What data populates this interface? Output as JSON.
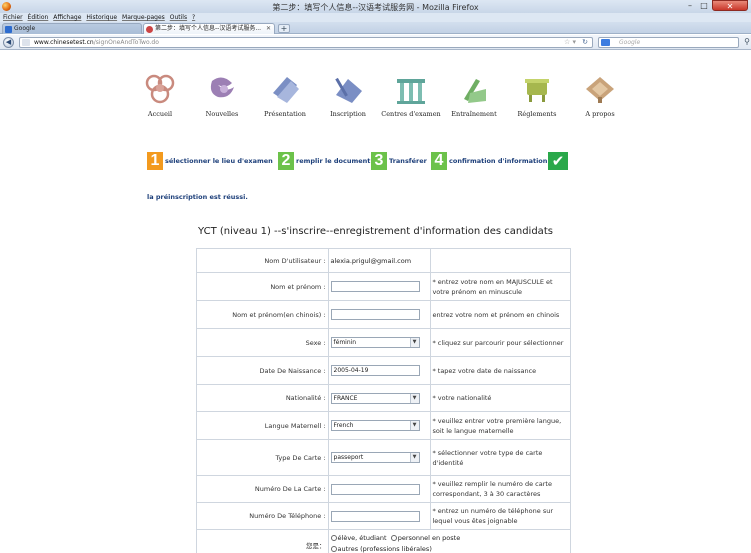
{
  "browser": {
    "window_title": "第二步：填写个人信息--汉语考试服务网 - Mozilla Firefox",
    "menu": [
      "Fichier",
      "Édition",
      "Affichage",
      "Historique",
      "Marque-pages",
      "Outils",
      "?"
    ],
    "tabs": [
      {
        "label": "Google"
      },
      {
        "label": "第二步：填写个人信息--汉语考试服务..."
      }
    ],
    "url_host": "www.chinesetest.cn",
    "url_path": "/signOneAndToTwo.do",
    "search_placeholder": "Google"
  },
  "nav": [
    {
      "label": "Accueil",
      "icon": "home-icon"
    },
    {
      "label": "Nouvelles",
      "icon": "news-icon"
    },
    {
      "label": "Présentation",
      "icon": "presentation-icon"
    },
    {
      "label": "Inscription",
      "icon": "inscription-icon"
    },
    {
      "label": "Centres d'examen",
      "icon": "exam-center-icon"
    },
    {
      "label": "Entraînement",
      "icon": "training-icon"
    },
    {
      "label": "Réglements",
      "icon": "rules-icon"
    },
    {
      "label": "A propos",
      "icon": "about-icon"
    }
  ],
  "steps": [
    {
      "num": "1",
      "label": "sélectionner le lieu d'examen",
      "color": "#f39a1e"
    },
    {
      "num": "2",
      "label": "remplir le document",
      "color": "#6cc24a"
    },
    {
      "num": "3",
      "label": "Transférer",
      "color": "#6cc24a"
    },
    {
      "num": "4",
      "label": "confirmation d'information",
      "color": "#6cc24a"
    }
  ],
  "success_message": "la préinscription est réussi.",
  "form_title": "YCT (niveau 1) --s'inscrire--enregistrement d'information des candidats",
  "form": {
    "username_label": "Nom D'utilisateur :",
    "username_value": "alexia.prigul@gmail.com",
    "rows": [
      {
        "label": "Nom et prénom :",
        "type": "input",
        "value": "",
        "hint": "* entrez votre nom en MAJUSCULE et votre prénom en minuscule"
      },
      {
        "label": "Nom et prénom(en chinois) :",
        "type": "input",
        "value": "",
        "hint": " entrez votre nom et prénom en chinois"
      },
      {
        "label": "Sexe :",
        "type": "select",
        "value": "féminin",
        "hint": "* cliquez sur parcourir pour sélectionner"
      },
      {
        "label": "Date De Naissance :",
        "type": "input",
        "value": "2005-04-19",
        "hint": "* tapez votre date de naissance"
      },
      {
        "label": "Nationalité :",
        "type": "select",
        "value": "FRANCE",
        "hint": "* votre nationalité"
      },
      {
        "label": "Langue Maternell :",
        "type": "select",
        "value": "French",
        "hint": "* veuillez entrer votre première langue, soit le langue maternelle"
      },
      {
        "label": "Type De Carte :",
        "type": "select",
        "value": "passeport",
        "hint": "* sélectionner votre type de carte d'identité"
      },
      {
        "label": "Numéro De La Carte :",
        "type": "input",
        "value": "",
        "hint": "* veuillez remplir le numéro de carte correspondant, 3 à 30 caractères"
      },
      {
        "label": "Numéro De Téléphone :",
        "type": "input",
        "value": "",
        "hint": "* entrez un numéro de téléphone sur lequel vous êtes joignable"
      }
    ],
    "status_label": "您是：",
    "status_options": [
      "élève, étudiant",
      "personnel en poste",
      "autres (professions libérales)"
    ]
  }
}
